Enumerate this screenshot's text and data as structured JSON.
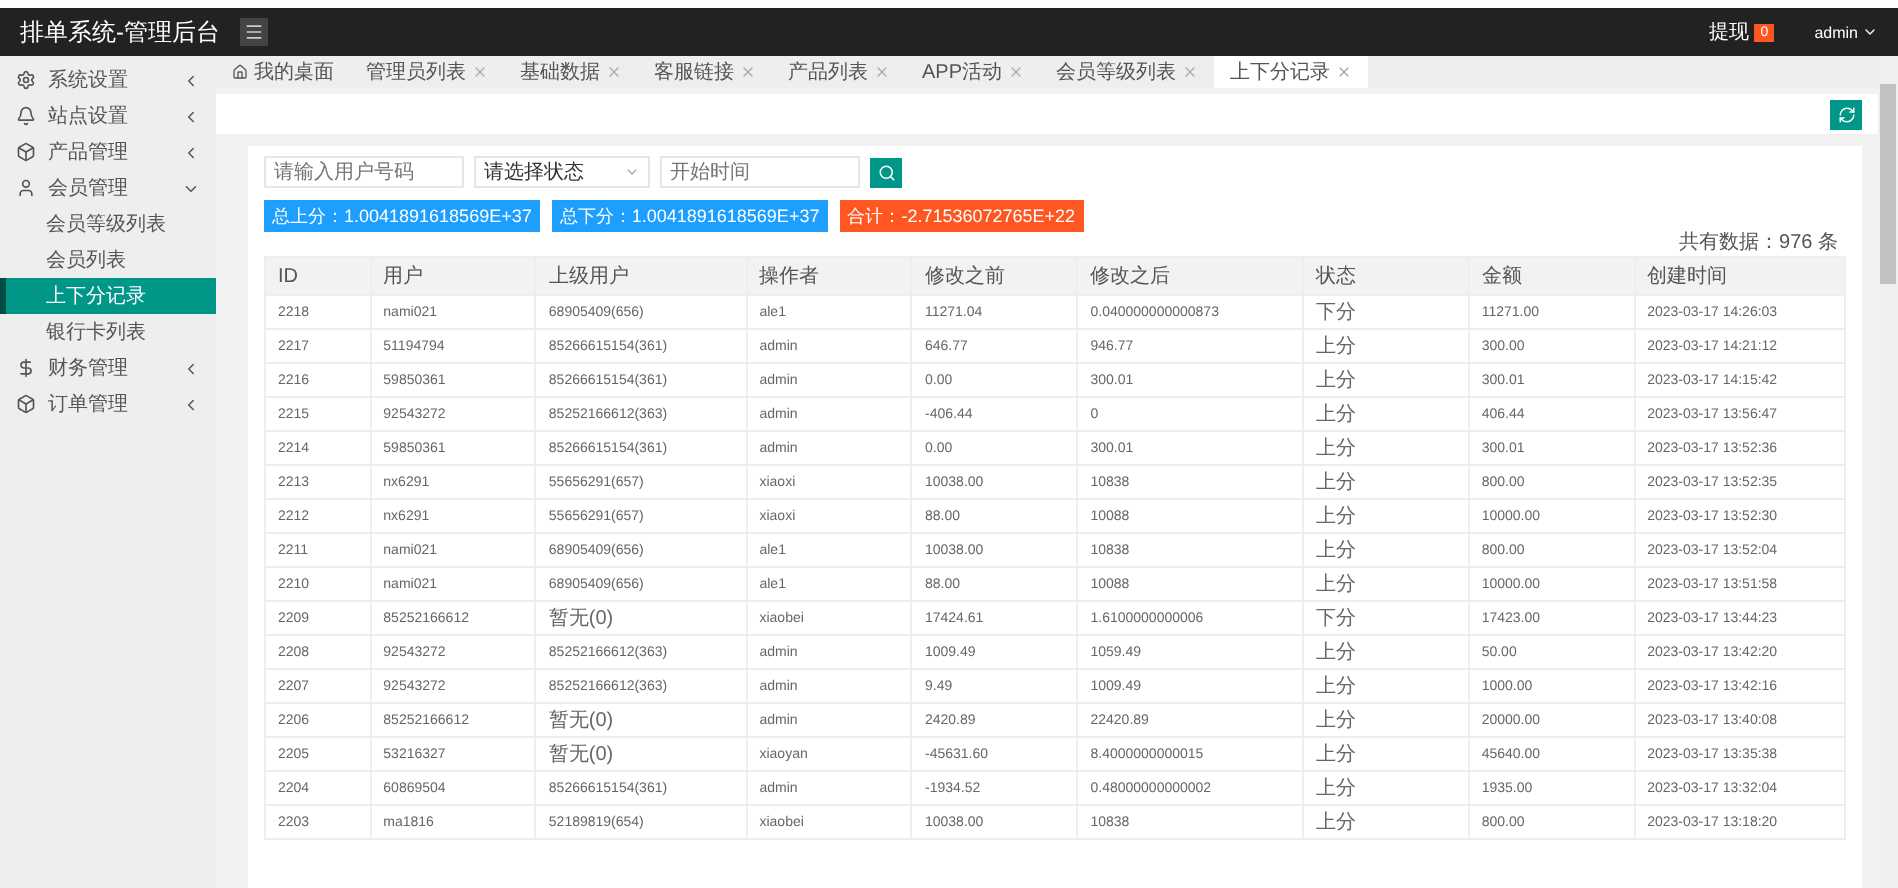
{
  "header": {
    "title": "排单系统-管理后台",
    "withdraw_label": "提现",
    "withdraw_count": "0",
    "user": "admin"
  },
  "sidebar": {
    "items": [
      {
        "label": "系统设置",
        "expanded": false
      },
      {
        "label": "站点设置",
        "expanded": false
      },
      {
        "label": "产品管理",
        "expanded": false
      },
      {
        "label": "会员管理",
        "expanded": true,
        "children": [
          {
            "label": "会员等级列表",
            "selected": false
          },
          {
            "label": "会员列表",
            "selected": false
          },
          {
            "label": "上下分记录",
            "selected": true
          },
          {
            "label": "银行卡列表",
            "selected": false
          }
        ]
      },
      {
        "label": "财务管理",
        "expanded": false
      },
      {
        "label": "订单管理",
        "expanded": false
      }
    ]
  },
  "tabs": [
    {
      "label": "我的桌面",
      "kind": "home",
      "selected": false
    },
    {
      "label": "管理员列表",
      "kind": "closable",
      "selected": false
    },
    {
      "label": "基础数据",
      "kind": "closable",
      "selected": false
    },
    {
      "label": "客服链接",
      "kind": "closable",
      "selected": false
    },
    {
      "label": "产品列表",
      "kind": "closable",
      "selected": false
    },
    {
      "label": "APP活动",
      "kind": "closable",
      "selected": false
    },
    {
      "label": "会员等级列表",
      "kind": "closable",
      "selected": false
    },
    {
      "label": "上下分记录",
      "kind": "closable",
      "selected": true
    }
  ],
  "filters": {
    "user_placeholder": "请输入用户号码",
    "status_placeholder": "请选择状态",
    "time_placeholder": "开始时间"
  },
  "summary": [
    {
      "text": "总上分：1.0041891618569E+37",
      "color": "#1e9fff"
    },
    {
      "text": "总下分：1.0041891618569E+37",
      "color": "#1e9fff"
    },
    {
      "text": "合计：-2.71536072765E+22",
      "color": "#ff5722"
    }
  ],
  "total": "共有数据：976 条",
  "table": {
    "columns": [
      "ID",
      "用户",
      "上级用户",
      "操作者",
      "修改之前",
      "修改之后",
      "状态",
      "金额",
      "创建时间"
    ],
    "rows": [
      [
        "2218",
        "nami021",
        "68905409(656)",
        "ale1",
        "11271.04",
        "0.040000000000873",
        "下分",
        "11271.00",
        "2023-03-17 14:26:03"
      ],
      [
        "2217",
        "51194794",
        "85266615154(361)",
        "admin",
        "646.77",
        "946.77",
        "上分",
        "300.00",
        "2023-03-17 14:21:12"
      ],
      [
        "2216",
        "59850361",
        "85266615154(361)",
        "admin",
        "0.00",
        "300.01",
        "上分",
        "300.01",
        "2023-03-17 14:15:42"
      ],
      [
        "2215",
        "92543272",
        "85252166612(363)",
        "admin",
        "-406.44",
        "0",
        "上分",
        "406.44",
        "2023-03-17 13:56:47"
      ],
      [
        "2214",
        "59850361",
        "85266615154(361)",
        "admin",
        "0.00",
        "300.01",
        "上分",
        "300.01",
        "2023-03-17 13:52:36"
      ],
      [
        "2213",
        "nx6291",
        "55656291(657)",
        "xiaoxi",
        "10038.00",
        "10838",
        "上分",
        "800.00",
        "2023-03-17 13:52:35"
      ],
      [
        "2212",
        "nx6291",
        "55656291(657)",
        "xiaoxi",
        "88.00",
        "10088",
        "上分",
        "10000.00",
        "2023-03-17 13:52:30"
      ],
      [
        "2211",
        "nami021",
        "68905409(656)",
        "ale1",
        "10038.00",
        "10838",
        "上分",
        "800.00",
        "2023-03-17 13:52:04"
      ],
      [
        "2210",
        "nami021",
        "68905409(656)",
        "ale1",
        "88.00",
        "10088",
        "上分",
        "10000.00",
        "2023-03-17 13:51:58"
      ],
      [
        "2209",
        "85252166612",
        "暂无(0)",
        "xiaobei",
        "17424.61",
        "1.6100000000006",
        "下分",
        "17423.00",
        "2023-03-17 13:44:23"
      ],
      [
        "2208",
        "92543272",
        "85252166612(363)",
        "admin",
        "1009.49",
        "1059.49",
        "上分",
        "50.00",
        "2023-03-17 13:42:20"
      ],
      [
        "2207",
        "92543272",
        "85252166612(363)",
        "admin",
        "9.49",
        "1009.49",
        "上分",
        "1000.00",
        "2023-03-17 13:42:16"
      ],
      [
        "2206",
        "85252166612",
        "暂无(0)",
        "admin",
        "2420.89",
        "22420.89",
        "上分",
        "20000.00",
        "2023-03-17 13:40:08"
      ],
      [
        "2205",
        "53216327",
        "暂无(0)",
        "xiaoyan",
        "-45631.60",
        "8.4000000000015",
        "上分",
        "45640.00",
        "2023-03-17 13:35:38"
      ],
      [
        "2204",
        "60869504",
        "85266615154(361)",
        "admin",
        "-1934.52",
        "0.48000000000002",
        "上分",
        "1935.00",
        "2023-03-17 13:32:04"
      ],
      [
        "2203",
        "ma1816",
        "52189819(654)",
        "xiaobei",
        "10038.00",
        "10838",
        "上分",
        "800.00",
        "2023-03-17 13:18:20"
      ]
    ]
  }
}
